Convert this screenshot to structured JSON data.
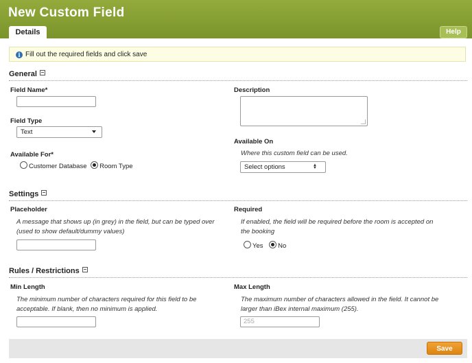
{
  "header": {
    "title": "New Custom Field",
    "tab_label": "Details",
    "help_label": "Help"
  },
  "notice": {
    "icon": "info-icon",
    "text": "Fill out the required fields and click save"
  },
  "general": {
    "heading": "General",
    "field_name": {
      "label": "Field Name*",
      "value": ""
    },
    "field_type": {
      "label": "Field Type",
      "selected": "Text"
    },
    "available_for": {
      "label": "Available For*",
      "options": [
        {
          "label": "Customer Database",
          "checked": false
        },
        {
          "label": "Room Type",
          "checked": true
        }
      ]
    },
    "description": {
      "label": "Description",
      "value": ""
    },
    "available_on": {
      "label": "Available On",
      "help": "Where this custom field can be used.",
      "selected": "Select options"
    }
  },
  "settings": {
    "heading": "Settings",
    "placeholder": {
      "label": "Placeholder",
      "help": "A message that shows up (in grey) in the field, but can be typed over (used to show default/dummy values)",
      "value": ""
    },
    "required": {
      "label": "Required",
      "help": "If enabled, the field will be required before the room is accepted on the booking",
      "options": [
        {
          "label": "Yes",
          "checked": false
        },
        {
          "label": "No",
          "checked": true
        }
      ]
    }
  },
  "rules": {
    "heading": "Rules / Restrictions",
    "min_length": {
      "label": "Min Length",
      "help": "The minimum number of characters required for this field to be acceptable. If blank, then no minimum is applied.",
      "value": ""
    },
    "max_length": {
      "label": "Max Length",
      "help": "The maximum number of characters allowed in the field. It cannot be larger than iBex internal maximum (255).",
      "placeholder": "255"
    }
  },
  "footer": {
    "save_label": "Save"
  }
}
